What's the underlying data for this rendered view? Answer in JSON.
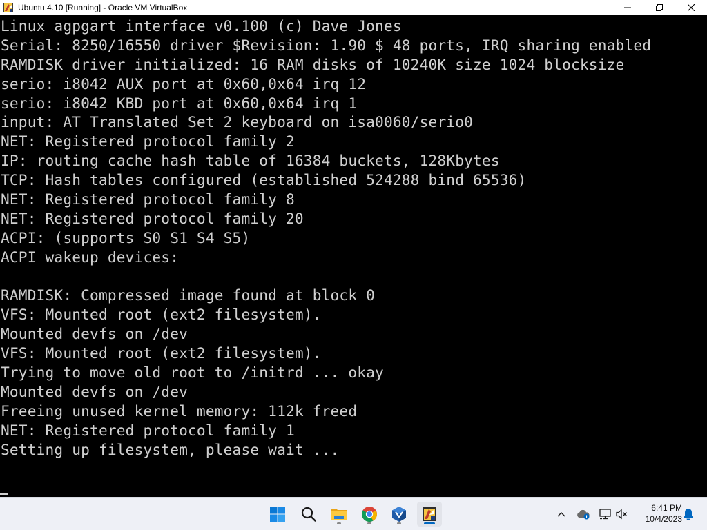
{
  "window": {
    "title": "Ubuntu 4.10 [Running] - Oracle VM VirtualBox",
    "controls": [
      "minimize",
      "maximize",
      "close"
    ]
  },
  "console": {
    "lines": [
      "Linux agpgart interface v0.100 (c) Dave Jones",
      "Serial: 8250/16550 driver $Revision: 1.90 $ 48 ports, IRQ sharing enabled",
      "RAMDISK driver initialized: 16 RAM disks of 10240K size 1024 blocksize",
      "serio: i8042 AUX port at 0x60,0x64 irq 12",
      "serio: i8042 KBD port at 0x60,0x64 irq 1",
      "input: AT Translated Set 2 keyboard on isa0060/serio0",
      "NET: Registered protocol family 2",
      "IP: routing cache hash table of 16384 buckets, 128Kbytes",
      "TCP: Hash tables configured (established 524288 bind 65536)",
      "NET: Registered protocol family 8",
      "NET: Registered protocol family 20",
      "ACPI: (supports S0 S1 S4 S5)",
      "ACPI wakeup devices:",
      "",
      "RAMDISK: Compressed image found at block 0",
      "VFS: Mounted root (ext2 filesystem).",
      "Mounted devfs on /dev",
      "VFS: Mounted root (ext2 filesystem).",
      "Trying to move old root to /initrd ... okay",
      "Mounted devfs on /dev",
      "Freeing unused kernel memory: 112k freed",
      "NET: Registered protocol family 1",
      "Setting up filesystem, please wait ..."
    ],
    "text_color": "#cfcfcf",
    "background": "#000000"
  },
  "taskbar": {
    "icons": [
      {
        "name": "start-icon"
      },
      {
        "name": "search-icon"
      },
      {
        "name": "file-explorer-icon"
      },
      {
        "name": "chrome-icon"
      },
      {
        "name": "virtualbox-manager-icon"
      },
      {
        "name": "virtualbox-vm-icon"
      }
    ],
    "tray": [
      {
        "name": "chevron-up-icon"
      },
      {
        "name": "onedrive-icon"
      },
      {
        "name": "network-icon"
      },
      {
        "name": "speaker-muted-icon"
      }
    ],
    "clock": {
      "time": "6:41 PM",
      "date": "10/4/2023"
    },
    "accent": "#0067c0"
  }
}
